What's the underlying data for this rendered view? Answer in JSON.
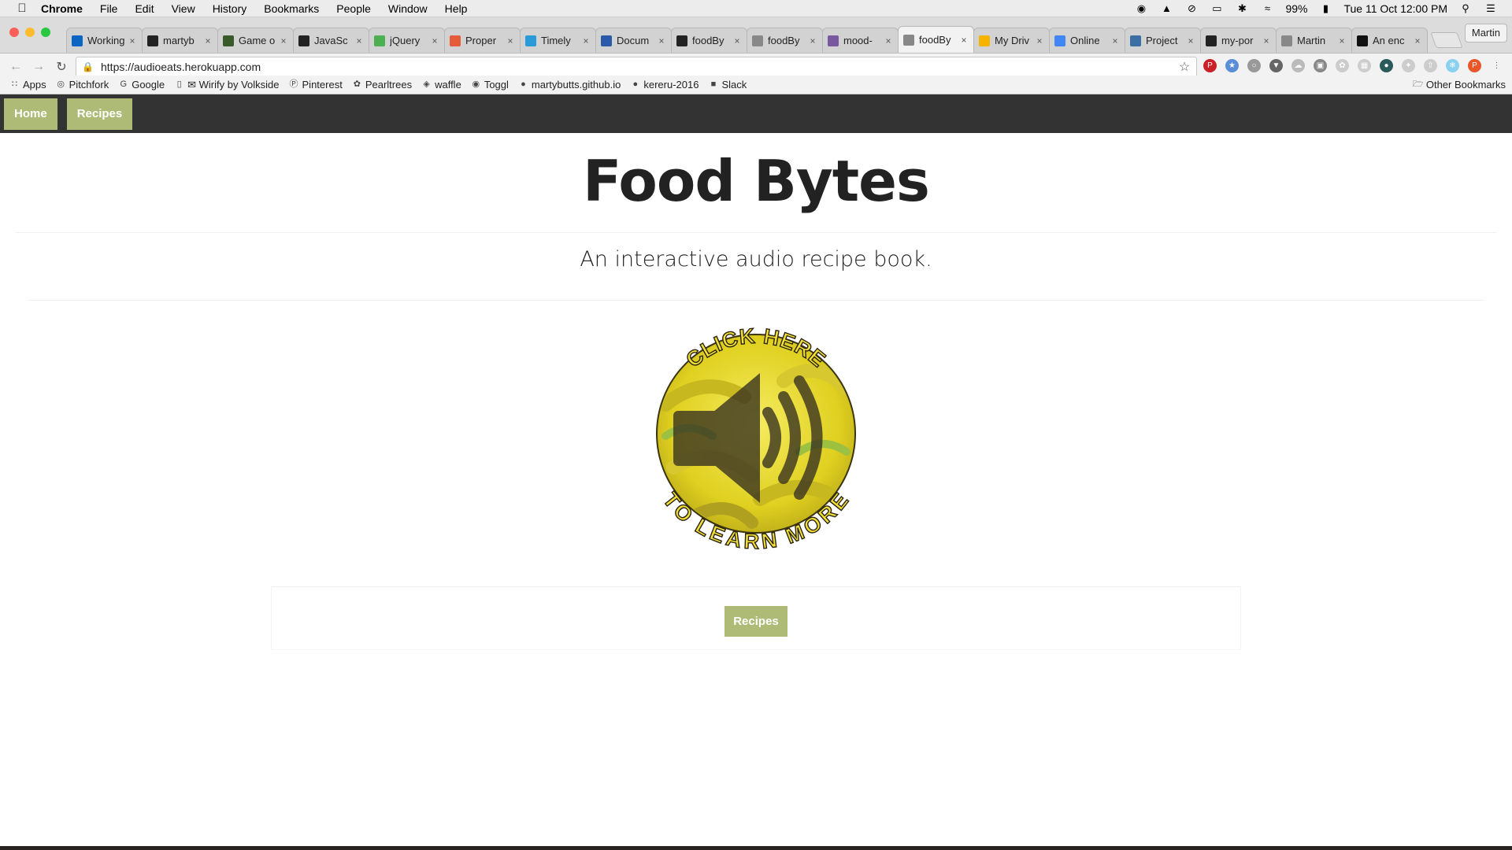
{
  "menubar": {
    "apple_icon": "apple-icon",
    "app_name": "Chrome",
    "items": [
      "File",
      "Edit",
      "View",
      "History",
      "Bookmarks",
      "People",
      "Window",
      "Help"
    ],
    "battery": "99%",
    "clock": "Tue 11 Oct  12:00 PM"
  },
  "tabs": [
    {
      "title": "Working",
      "icon": "linkedin-icon",
      "color": "#0a66c2"
    },
    {
      "title": "martyb",
      "icon": "github-icon",
      "color": "#222222"
    },
    {
      "title": "Game o",
      "icon": "game-icon",
      "color": "#3a5a2a"
    },
    {
      "title": "JavaSc",
      "icon": "bootstrap-icon",
      "color": "#222222"
    },
    {
      "title": "jQuery",
      "icon": "w3schools-icon",
      "color": "#4caf50"
    },
    {
      "title": "Proper",
      "icon": "location-icon",
      "color": "#e65c3a"
    },
    {
      "title": "Timely",
      "icon": "timely-icon",
      "color": "#2a9ad8"
    },
    {
      "title": "Docum",
      "icon": "docs-icon",
      "color": "#2a5aa8"
    },
    {
      "title": "foodBy",
      "icon": "github-icon",
      "color": "#222222"
    },
    {
      "title": "foodBy",
      "icon": "page-icon",
      "color": "#888888"
    },
    {
      "title": "mood-",
      "icon": "heroku-icon",
      "color": "#79589f"
    },
    {
      "title": "foodBy",
      "icon": "page-icon",
      "color": "#888888",
      "active": true
    },
    {
      "title": "My Driv",
      "icon": "drive-icon",
      "color": "#f4b400"
    },
    {
      "title": "Online",
      "icon": "docs-icon",
      "color": "#4285f4"
    },
    {
      "title": "Project",
      "icon": "person-icon",
      "color": "#3a6ea5"
    },
    {
      "title": "my-por",
      "icon": "github-icon",
      "color": "#222222"
    },
    {
      "title": "Martin",
      "icon": "page-icon",
      "color": "#888888"
    },
    {
      "title": "An enc",
      "icon": "aut-icon",
      "color": "#111111"
    }
  ],
  "profile": "Martin",
  "address_bar": {
    "url": "https://audioeats.herokuapp.com"
  },
  "bookmarks": [
    {
      "label": "Apps",
      "icon": "apps-grid-icon"
    },
    {
      "label": "Pitchfork",
      "icon": "pitchfork-icon"
    },
    {
      "label": "Google",
      "icon": "google-icon"
    },
    {
      "label": "✉ Wirify by Volkside",
      "icon": "page-icon"
    },
    {
      "label": "Pinterest",
      "icon": "pinterest-icon"
    },
    {
      "label": "Pearltrees",
      "icon": "pearltrees-icon"
    },
    {
      "label": "waffle",
      "icon": "waffle-icon"
    },
    {
      "label": "Toggl",
      "icon": "toggl-icon"
    },
    {
      "label": "martybutts.github.io",
      "icon": "github-icon"
    },
    {
      "label": "kereru-2016",
      "icon": "github-icon"
    },
    {
      "label": "Slack",
      "icon": "slack-icon"
    }
  ],
  "other_bookmarks": "Other Bookmarks",
  "site": {
    "nav": [
      "Home",
      "Recipes"
    ],
    "title": "Food Bytes",
    "subtitle": "An interactive audio recipe book.",
    "badge_top_text": "CLICK HERE",
    "badge_bottom_text": "TO LEARN MORE",
    "recipes_button": "Recipes"
  },
  "colors": {
    "accent": "#aebb76",
    "nav_bg": "#333333",
    "badge_yellow": "#f0e040"
  }
}
